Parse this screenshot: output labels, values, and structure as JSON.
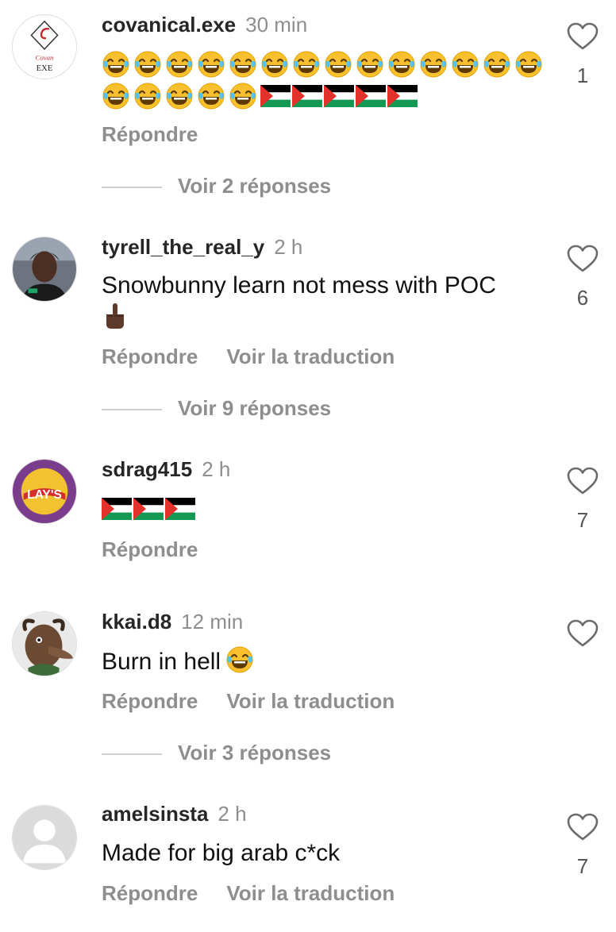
{
  "comments": [
    {
      "username": "covanical.exe",
      "time": "30 min",
      "reply_label": "Répondre",
      "likes": "1",
      "view_replies": "Voir 2 réponses",
      "avatar_text_top": "Covan",
      "avatar_text_bottom": "EXE"
    },
    {
      "username": "tyrell_the_real_y",
      "time": "2 h",
      "text": "Snowbunny learn not mess with POC",
      "reply_label": "Répondre",
      "translate_label": "Voir la traduction",
      "likes": "6",
      "view_replies": "Voir 9 réponses"
    },
    {
      "username": "sdrag415",
      "time": "2 h",
      "reply_label": "Répondre",
      "likes": "7",
      "avatar_text": "LAY'S"
    },
    {
      "username": "kkai.d8",
      "time": "12 min",
      "text": "Burn in hell",
      "reply_label": "Répondre",
      "translate_label": "Voir la traduction",
      "view_replies": "Voir 3 réponses"
    },
    {
      "username": "amelsinsta",
      "time": "2 h",
      "text": "Made for big arab c*ck",
      "reply_label": "Répondre",
      "translate_label": "Voir la traduction",
      "likes": "7"
    }
  ],
  "emoji": {
    "laugh": "face-with-tears-of-joy",
    "flag": "palestine-flag",
    "finger": "middle-finger"
  },
  "colors": {
    "secondary_text": "#8e8e8e",
    "flag_black": "#000000",
    "flag_green": "#149954",
    "flag_red": "#e4312b",
    "emoji_yellow": "#fbc02d"
  }
}
